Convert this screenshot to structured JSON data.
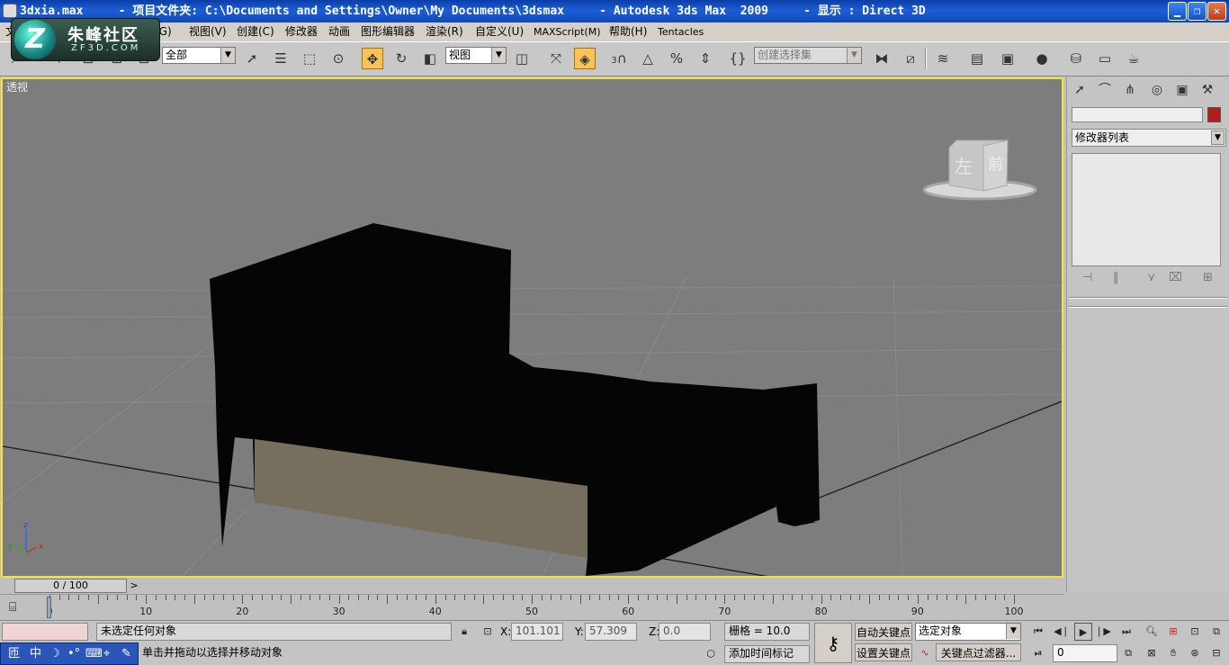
{
  "titlebar": {
    "title": "3dxia.max     - 项目文件夹: C:\\Documents and Settings\\Owner\\My Documents\\3dsmax     - Autodesk 3ds Max  2009     - 显示 : Direct 3D"
  },
  "logo": {
    "mark": "Z",
    "name": "朱峰社区",
    "url": "ZF3D.COM"
  },
  "menu": {
    "items": [
      "文",
      "组(G)",
      "视图(V)",
      "创建(C)",
      "修改器",
      "动画",
      "图形编辑器",
      "渲染(R)",
      "自定义(U)",
      "MAXScript(M)",
      "帮助(H)",
      "Tentacles"
    ]
  },
  "toolbar": {
    "selection_filter": "全部",
    "ref_coord": "视图",
    "named_selection_placeholder": "创建选择集",
    "snap_label": "3"
  },
  "viewport": {
    "label": "透视",
    "viewcube_left": "左",
    "viewcube_front": "前",
    "axis_z": "z",
    "axis_x": "x",
    "axis_y": "y"
  },
  "command_panel": {
    "modifier_list": "修改器列表"
  },
  "timeline": {
    "slider_text": "0 / 100",
    "ruler_labels": [
      "0",
      "10",
      "20",
      "30",
      "40",
      "50",
      "60",
      "70",
      "80",
      "90",
      "100"
    ]
  },
  "status": {
    "selection_text": "未选定任何对象",
    "prompt_text": "单击并拖动以选择并移动对象",
    "x_label": "X:",
    "x_value": "101.101",
    "y_label": "Y:",
    "y_value": "57.309",
    "z_label": "Z:",
    "z_value": "0.0",
    "grid": "栅格 = 10.0",
    "add_time_tag": "添加时间标记",
    "auto_key": "自动关键点",
    "set_key": "设置关键点",
    "key_mode": "选定对象",
    "key_filters": "关键点过滤器...",
    "frame": "0"
  },
  "ime": {
    "items": [
      "匝",
      "中",
      "☽",
      "•°",
      "⌨",
      "⌖",
      "✎"
    ]
  }
}
